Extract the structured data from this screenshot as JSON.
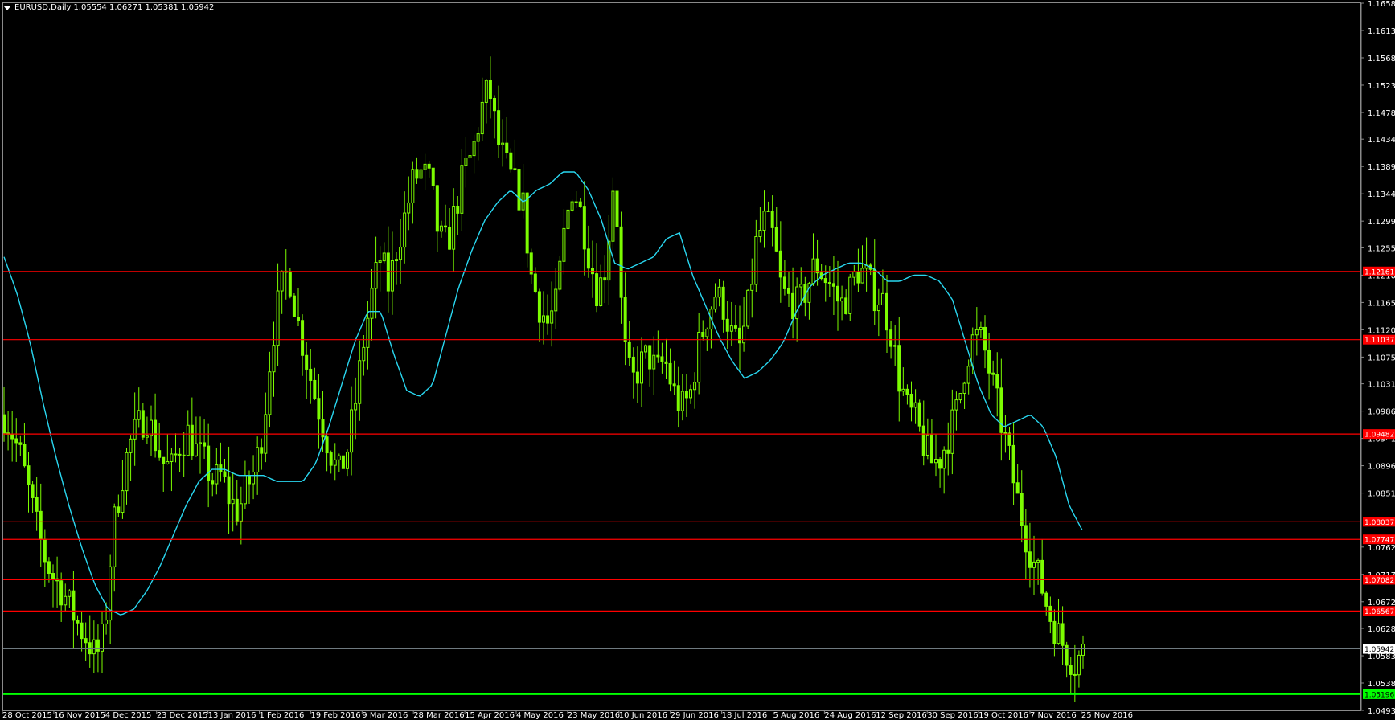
{
  "header": {
    "symbol": "EURUSD,Daily",
    "ohlc": "1.05554 1.06271 1.05381 1.05942"
  },
  "colors": {
    "background": "#000000",
    "candles": "#7CFC00",
    "ma": "#29D7F0",
    "levels": "#FF0000",
    "support": "#00FF00",
    "frame": "#8A8A8A"
  },
  "icons": {
    "menu": "triangle-down-icon"
  },
  "chart_data": {
    "type": "candlestick",
    "symbol": "EURUSD",
    "timeframe": "Daily",
    "y_ticks": [
      "1.16580",
      "1.16130",
      "1.15680",
      "1.15230",
      "1.14780",
      "1.14340",
      "1.13890",
      "1.13440",
      "1.12990",
      "1.12550",
      "1.12100",
      "1.11650",
      "1.11200",
      "1.10750",
      "1.10310",
      "1.09860",
      "1.09410",
      "1.08960",
      "1.08510",
      "1.07620",
      "1.07170",
      "1.06720",
      "1.06280",
      "1.05830",
      "1.05380",
      "1.04930"
    ],
    "x_ticks": [
      "28 Oct 2015",
      "16 Nov 2015",
      "4 Dec 2015",
      "23 Dec 2015",
      "13 Jan 2016",
      "1 Feb 2016",
      "19 Feb 2016",
      "9 Mar 2016",
      "28 Mar 2016",
      "15 Apr 2016",
      "4 May 2016",
      "23 May 2016",
      "10 Jun 2016",
      "29 Jun 2016",
      "18 Jul 2016",
      "5 Aug 2016",
      "24 Aug 2016",
      "12 Sep 2016",
      "30 Sep 2016",
      "19 Oct 2016",
      "7 Nov 2016",
      "25 Nov 2016"
    ],
    "ylim": [
      1.0493,
      1.1658
    ],
    "horizontal_levels": [
      {
        "label": "1.12161",
        "value": 1.12161,
        "color": "#FF0000"
      },
      {
        "label": "1.11037",
        "value": 1.11037,
        "color": "#FF0000"
      },
      {
        "label": "1.09482",
        "value": 1.09482,
        "color": "#FF0000"
      },
      {
        "label": "1.08037",
        "value": 1.08037,
        "color": "#FF0000"
      },
      {
        "label": "1.07747",
        "value": 1.07747,
        "color": "#FF0000"
      },
      {
        "label": "1.07082",
        "value": 1.07082,
        "color": "#FF0000"
      },
      {
        "label": "1.06567",
        "value": 1.06567,
        "color": "#FF0000"
      },
      {
        "label": "1.05942",
        "value": 1.05942,
        "color": "#FFFFFF",
        "kind": "bid"
      },
      {
        "label": "1.05196",
        "value": 1.05196,
        "color": "#00FF00",
        "kind": "support"
      }
    ],
    "price_anchors": [
      1.098,
      1.095,
      1.091,
      1.085,
      1.079,
      1.074,
      1.071,
      1.069,
      1.066,
      1.063,
      1.061,
      1.058,
      1.062,
      1.079,
      1.087,
      1.093,
      1.096,
      1.098,
      1.094,
      1.09,
      1.089,
      1.093,
      1.095,
      1.092,
      1.09,
      1.087,
      1.088,
      1.084,
      1.082,
      1.086,
      1.089,
      1.096,
      1.11,
      1.118,
      1.122,
      1.114,
      1.108,
      1.102,
      1.097,
      1.092,
      1.088,
      1.092,
      1.1,
      1.11,
      1.118,
      1.124,
      1.119,
      1.126,
      1.131,
      1.137,
      1.138,
      1.136,
      1.127,
      1.126,
      1.132,
      1.138,
      1.141,
      1.148,
      1.152,
      1.143,
      1.139,
      1.136,
      1.133,
      1.121,
      1.116,
      1.113,
      1.116,
      1.128,
      1.136,
      1.131,
      1.124,
      1.118,
      1.123,
      1.139,
      1.11,
      1.103,
      1.106,
      1.108,
      1.105,
      1.107,
      1.102,
      1.099,
      1.101,
      1.109,
      1.114,
      1.118,
      1.116,
      1.111,
      1.109,
      1.116,
      1.127,
      1.13,
      1.127,
      1.118,
      1.117,
      1.116,
      1.119,
      1.123,
      1.121,
      1.119,
      1.116,
      1.118,
      1.122,
      1.121,
      1.118,
      1.117,
      1.112,
      1.104,
      1.099,
      1.097,
      1.093,
      1.09,
      1.091,
      1.095,
      1.099,
      1.107,
      1.111,
      1.11,
      1.104,
      1.098,
      1.092,
      1.085,
      1.079,
      1.074,
      1.07,
      1.065,
      1.062,
      1.059,
      1.057,
      1.059
    ],
    "ma_anchors": [
      1.124,
      1.118,
      1.11,
      1.1,
      1.091,
      1.083,
      1.076,
      1.07,
      1.066,
      1.065,
      1.066,
      1.069,
      1.073,
      1.078,
      1.083,
      1.087,
      1.089,
      1.089,
      1.088,
      1.088,
      1.088,
      1.087,
      1.087,
      1.087,
      1.09,
      1.096,
      1.103,
      1.11,
      1.115,
      1.115,
      1.108,
      1.102,
      1.101,
      1.103,
      1.111,
      1.119,
      1.125,
      1.13,
      1.133,
      1.135,
      1.133,
      1.135,
      1.136,
      1.138,
      1.138,
      1.135,
      1.13,
      1.123,
      1.122,
      1.123,
      1.124,
      1.127,
      1.128,
      1.121,
      1.116,
      1.111,
      1.107,
      1.104,
      1.105,
      1.107,
      1.11,
      1.115,
      1.119,
      1.121,
      1.122,
      1.123,
      1.123,
      1.122,
      1.12,
      1.12,
      1.121,
      1.121,
      1.12,
      1.117,
      1.11,
      1.103,
      1.098,
      1.096,
      1.097,
      1.098,
      1.096,
      1.091,
      1.083,
      1.079
    ]
  }
}
